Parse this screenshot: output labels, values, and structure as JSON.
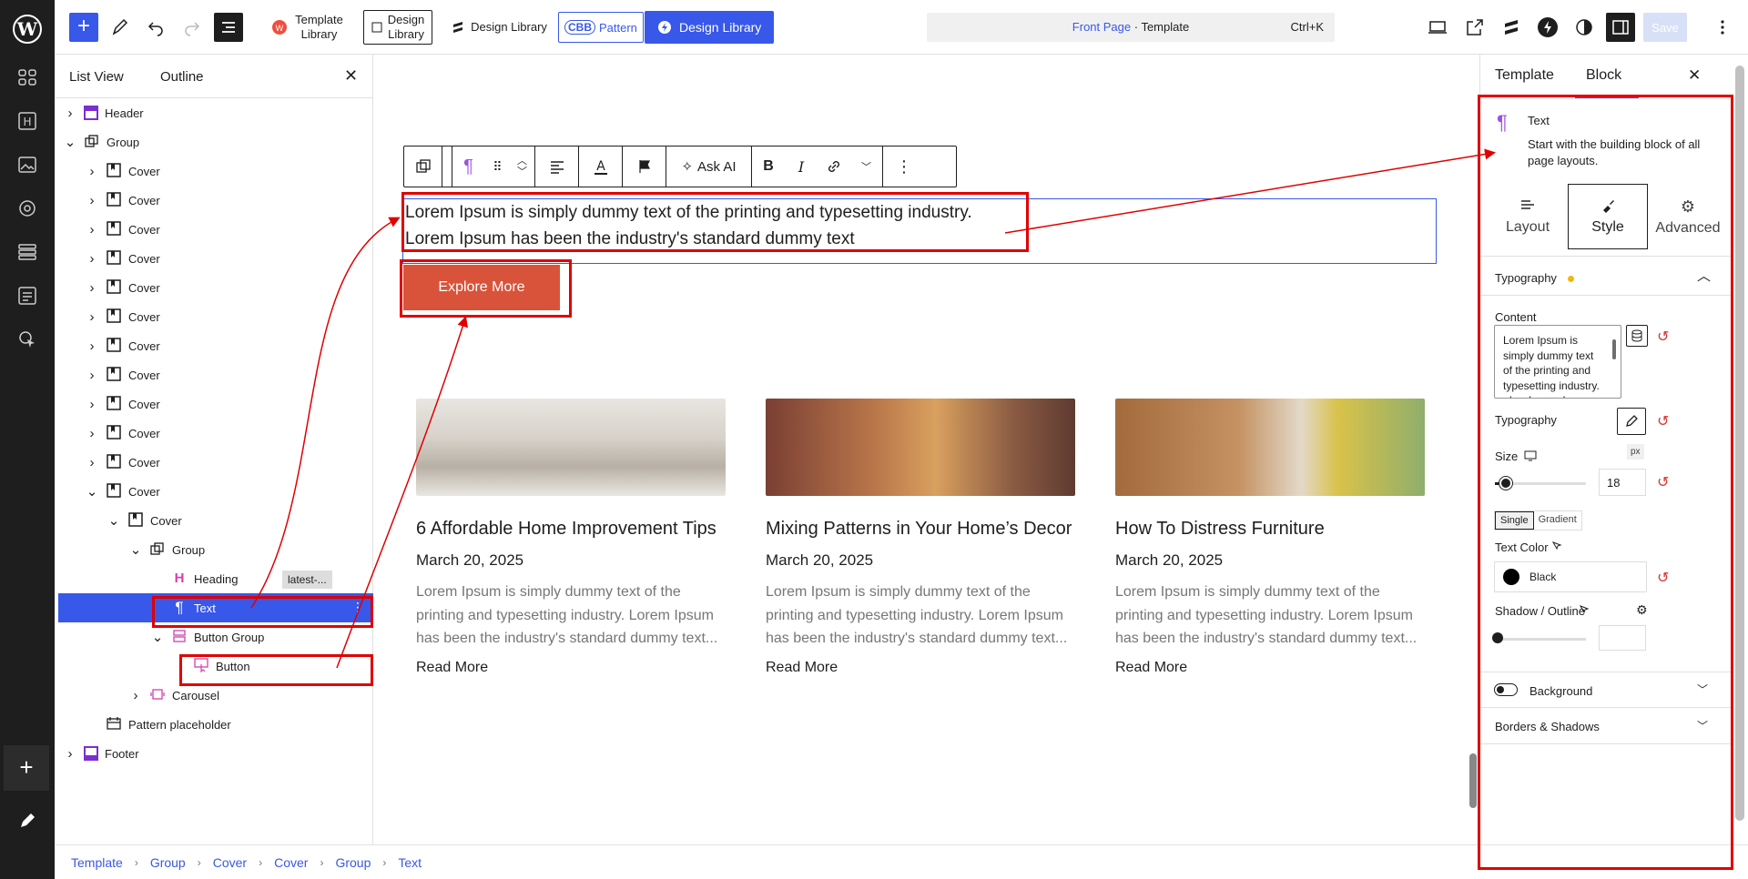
{
  "topbar": {
    "tools": [
      "add-block",
      "pencil",
      "undo",
      "redo",
      "list-view"
    ],
    "template_library": "Template\nLibrary",
    "design_library_boxed": "Design\nLibrary",
    "design_library": "Design Library",
    "cbb_label": "CBB",
    "pattern_label": "Pattern",
    "design_library_blue": "Design Library",
    "command": {
      "page": "Front Page",
      "sep": " · ",
      "type": "Template",
      "shortcut": "Ctrl+K"
    },
    "save_label": "Save"
  },
  "admin_nav": [
    "wordpress-logo",
    "dashboard",
    "heading",
    "media",
    "settings",
    "patterns",
    "styles",
    "cursor"
  ],
  "listview": {
    "tabs": [
      "List View",
      "Outline"
    ],
    "rows": [
      {
        "label": "Header",
        "depth": 0,
        "chev": "right",
        "icon": "header"
      },
      {
        "label": "Group",
        "depth": 0,
        "chev": "down",
        "icon": "group"
      },
      {
        "label": "Cover",
        "depth": 1,
        "chev": "right",
        "icon": "cover"
      },
      {
        "label": "Cover",
        "depth": 1,
        "chev": "right",
        "icon": "cover"
      },
      {
        "label": "Cover",
        "depth": 1,
        "chev": "right",
        "icon": "cover"
      },
      {
        "label": "Cover",
        "depth": 1,
        "chev": "right",
        "icon": "cover"
      },
      {
        "label": "Cover",
        "depth": 1,
        "chev": "right",
        "icon": "cover"
      },
      {
        "label": "Cover",
        "depth": 1,
        "chev": "right",
        "icon": "cover"
      },
      {
        "label": "Cover",
        "depth": 1,
        "chev": "right",
        "icon": "cover"
      },
      {
        "label": "Cover",
        "depth": 1,
        "chev": "right",
        "icon": "cover"
      },
      {
        "label": "Cover",
        "depth": 1,
        "chev": "right",
        "icon": "cover"
      },
      {
        "label": "Cover",
        "depth": 1,
        "chev": "right",
        "icon": "cover"
      },
      {
        "label": "Cover",
        "depth": 1,
        "chev": "right",
        "icon": "cover"
      },
      {
        "label": "Cover",
        "depth": 1,
        "chev": "down",
        "icon": "cover"
      },
      {
        "label": "Cover",
        "depth": 2,
        "chev": "down",
        "icon": "cover"
      },
      {
        "label": "Group",
        "depth": 3,
        "chev": "down",
        "icon": "group"
      },
      {
        "label": "Heading",
        "depth": 4,
        "chev": "",
        "icon": "heading",
        "badge": "latest-..."
      },
      {
        "label": "Text",
        "depth": 4,
        "chev": "",
        "icon": "paragraph",
        "selected": true
      },
      {
        "label": "Button Group",
        "depth": 4,
        "chev": "down",
        "icon": "buttongroup"
      },
      {
        "label": "Button",
        "depth": 5,
        "chev": "",
        "icon": "button"
      },
      {
        "label": "Carousel",
        "depth": 3,
        "chev": "right",
        "icon": "carousel"
      },
      {
        "label": "Pattern placeholder",
        "depth": 1,
        "chev": "",
        "icon": "placeholder"
      },
      {
        "label": "Footer",
        "depth": 0,
        "chev": "right",
        "icon": "footer"
      }
    ]
  },
  "canvas": {
    "block_toolbar": {
      "ask_ai": "Ask AI"
    },
    "text_line1": "Lorem Ipsum is simply dummy text of the printing and typesetting industry.",
    "text_line2": "Lorem Ipsum has been the industry's standard dummy text",
    "explore_button": "Explore More",
    "cards": [
      {
        "title": "6 Affordable Home Improvement Tips",
        "date": "March 20, 2025",
        "excerpt": "Lorem Ipsum is simply dummy text of the printing and typesetting industry. Lorem Ipsum has been the industry's standard dummy text...",
        "read_more": "Read More"
      },
      {
        "title": "Mixing Patterns in Your Home’s Decor",
        "date": "March 20, 2025",
        "excerpt": "Lorem Ipsum is simply dummy text of the printing and typesetting industry. Lorem Ipsum has been the industry's standard dummy text...",
        "read_more": "Read More"
      },
      {
        "title": "How To Distress Furniture",
        "date": "March 20, 2025",
        "excerpt": "Lorem Ipsum is simply dummy text of the printing and typesetting industry. Lorem Ipsum has been the industry's standard dummy text...",
        "read_more": "Read More"
      }
    ]
  },
  "breadcrumb": [
    "Template",
    "Group",
    "Cover",
    "Cover",
    "Group",
    "Text"
  ],
  "settings": {
    "tabs": [
      "Template",
      "Block"
    ],
    "block_name": "Text",
    "block_desc": "Start with the building block of all page layouts.",
    "subtabs": [
      "Layout",
      "Style",
      "Advanced"
    ],
    "typography_section": "Typography",
    "content_label": "Content",
    "content_value": "Lorem Ipsum is simply dummy text of the printing and typesetting industry. <br> Lorem Ipsum has been the industry's standard dummy text",
    "typography_label": "Typography",
    "size_label": "Size",
    "size_unit": "px",
    "size_value": "18",
    "size_fraction": 0.12,
    "color_modes": [
      "Single",
      "Gradient"
    ],
    "text_color_label": "Text Color",
    "text_color_value": "Black",
    "shadow_label": "Shadow / Outline",
    "background_label": "Background",
    "borders_label": "Borders & Shadows"
  },
  "colors": {
    "accent": "#3858e9",
    "button": "#d9533a",
    "annotation": "#e00000",
    "reset": "#d63638"
  }
}
